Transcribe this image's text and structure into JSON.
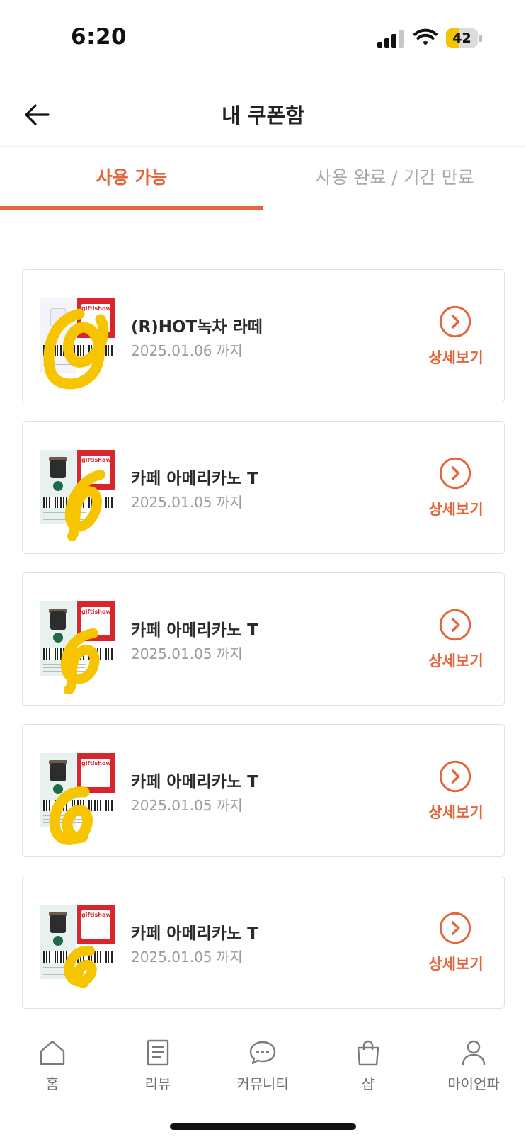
{
  "status_bar": {
    "time": "6:20",
    "battery": "42",
    "battery_level": 0.42
  },
  "header": {
    "title": "내 쿠폰함",
    "back_icon": "arrow-left-icon"
  },
  "tabs": [
    {
      "label": "사용 가능",
      "active": true
    },
    {
      "label": "사용 완료 / 기간 만료",
      "active": false
    }
  ],
  "coupons": [
    {
      "name": "(R)HOT녹차 라떼",
      "expiry": "2025.01.06 까지",
      "detail_label": "상세보기"
    },
    {
      "name": "카페 아메리카노 T",
      "expiry": "2025.01.05 까지",
      "detail_label": "상세보기"
    },
    {
      "name": "카페 아메리카노 T",
      "expiry": "2025.01.05 까지",
      "detail_label": "상세보기"
    },
    {
      "name": "카페 아메리카노 T",
      "expiry": "2025.01.05 까지",
      "detail_label": "상세보기"
    },
    {
      "name": "카페 아메리카노 T",
      "expiry": "2025.01.05 까지",
      "detail_label": "상세보기"
    }
  ],
  "thumb_brand_text": "giftishow",
  "bottom_nav": [
    {
      "label": "홈",
      "icon": "home-icon"
    },
    {
      "label": "리뷰",
      "icon": "document-icon"
    },
    {
      "label": "커뮤니티",
      "icon": "chat-bubble-icon"
    },
    {
      "label": "샵",
      "icon": "shopping-bag-icon"
    },
    {
      "label": "마이언파",
      "icon": "person-icon"
    }
  ],
  "colors": {
    "accent": "#e5653a",
    "redaction": "#f6c500",
    "gift_red": "#d9252c"
  }
}
